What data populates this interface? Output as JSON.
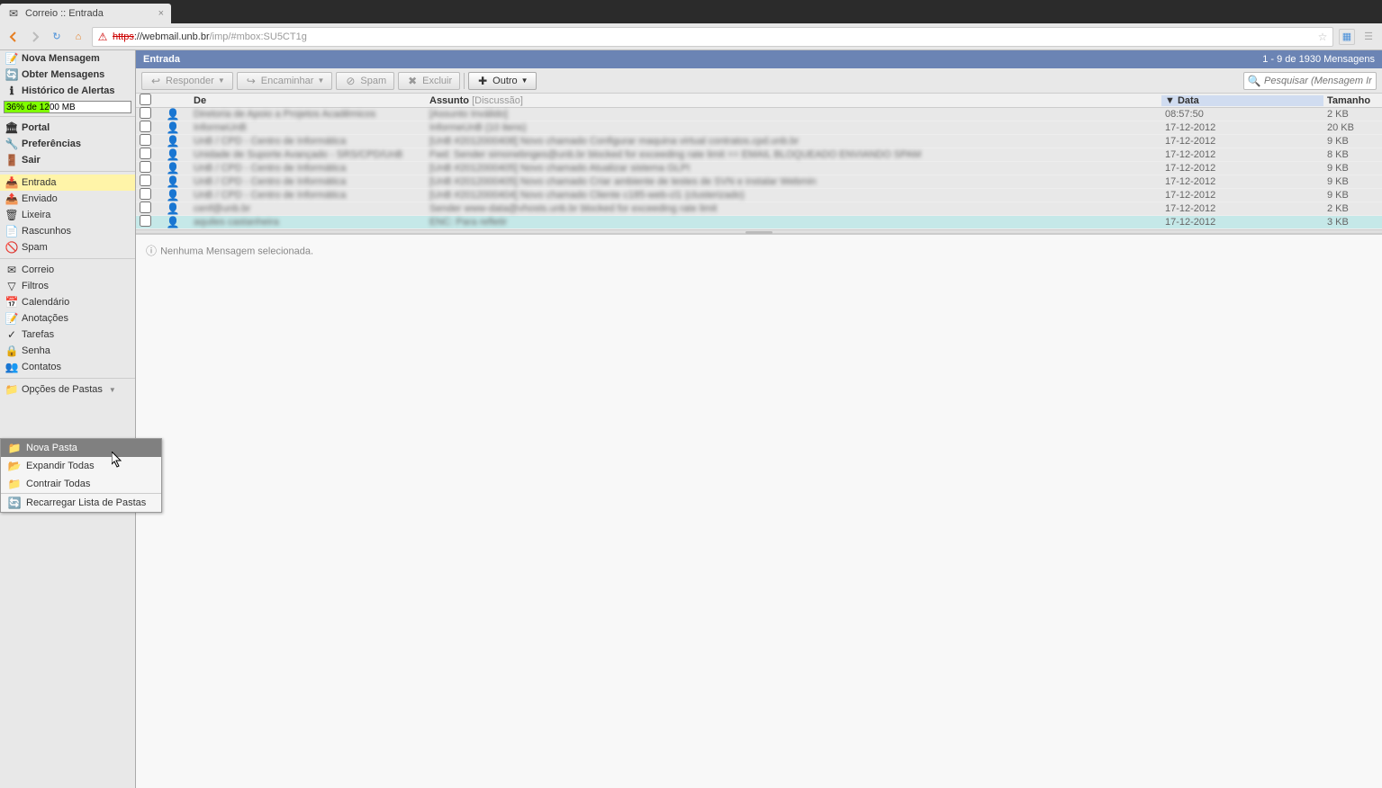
{
  "browser": {
    "tab_title": "Correio :: Entrada",
    "url_protocol": "https",
    "url_host": "://webmail.unb.br",
    "url_path": "/imp/#mbox:SU5CT1g"
  },
  "sidebar": {
    "actions": {
      "new_msg": "Nova Mensagem",
      "get_msg": "Obter Mensagens",
      "alerts": "Histórico de Alertas"
    },
    "quota_text": "36% de 1200 MB",
    "nav": {
      "portal": "Portal",
      "prefs": "Preferências",
      "exit": "Sair"
    },
    "folders": {
      "inbox": "Entrada",
      "sent": "Enviado",
      "trash": "Lixeira",
      "drafts": "Rascunhos",
      "spam": "Spam"
    },
    "apps": {
      "mail": "Correio",
      "filters": "Filtros",
      "calendar": "Calendário",
      "notes": "Anotações",
      "tasks": "Tarefas",
      "password": "Senha",
      "contacts": "Contatos"
    },
    "folder_opts": "Opções de Pastas"
  },
  "context_menu": {
    "new_folder": "Nova Pasta",
    "expand": "Expandir Todas",
    "collapse": "Contrair Todas",
    "reload": "Recarregar Lista de Pastas"
  },
  "header": {
    "folder": "Entrada",
    "count": "1 - 9 de 1930 Mensagens"
  },
  "toolbar": {
    "reply": "Responder",
    "forward": "Encaminhar",
    "spam": "Spam",
    "delete": "Excluir",
    "other": "Outro",
    "search_placeholder": "Pesquisar (Mensagem Inteira)"
  },
  "columns": {
    "from": "De",
    "subject": "Assunto",
    "discussion": "[Discussão]",
    "date": "Data",
    "size": "Tamanho"
  },
  "messages": [
    {
      "from": "Diretoria de Apoio a Projetos Acadêmicos",
      "subject": "[Assunto Inválido]",
      "date": "08:57:50",
      "size": "2 KB",
      "blur": true,
      "sel": false
    },
    {
      "from": "InformeUnB",
      "subject": "InformeUnB (10 itens)",
      "date": "17-12-2012",
      "size": "20 KB",
      "blur": true,
      "sel": false
    },
    {
      "from": "UnB / CPD - Centro de Informática",
      "subject": "[UnB #2012000408] Novo chamado Configurar maquina virtual contratos.cpd.unb.br",
      "date": "17-12-2012",
      "size": "9 KB",
      "blur": true,
      "sel": false
    },
    {
      "from": "Unidade de Suporte Avançado - SRS/CPD/UnB",
      "subject": "Fwd: Sender simonebnges@unb.br blocked for exceeding rate limit == EMAIL BLOQUEADO ENVIANDO SPAM",
      "date": "17-12-2012",
      "size": "8 KB",
      "blur": true,
      "sel": false
    },
    {
      "from": "UnB / CPD - Centro de Informática",
      "subject": "[UnB #2012000405] Novo chamado Atualizar sistema GLPI",
      "date": "17-12-2012",
      "size": "9 KB",
      "blur": true,
      "sel": false
    },
    {
      "from": "UnB / CPD - Centro de Informática",
      "subject": "[UnB #2012000405] Novo chamado Criar ambiente de testes de SVN e instalar Webmin",
      "date": "17-12-2012",
      "size": "9 KB",
      "blur": true,
      "sel": false
    },
    {
      "from": "UnB / CPD - Centro de Informática",
      "subject": "[UnB #2012000404] Novo chamado Cliente c185-web-cl1 (clusterizado)",
      "date": "17-12-2012",
      "size": "9 KB",
      "blur": true,
      "sel": false
    },
    {
      "from": "cenf@unb.br",
      "subject": "Sender www-data@vhosts.unb.br blocked for exceeding rate limit",
      "date": "17-12-2012",
      "size": "2 KB",
      "blur": true,
      "sel": false
    },
    {
      "from": "aquiles castanheira",
      "subject": "ENC: Para refletir",
      "date": "17-12-2012",
      "size": "3 KB",
      "blur": true,
      "sel": true
    }
  ],
  "preview": {
    "empty": "Nenhuma Mensagem selecionada."
  }
}
